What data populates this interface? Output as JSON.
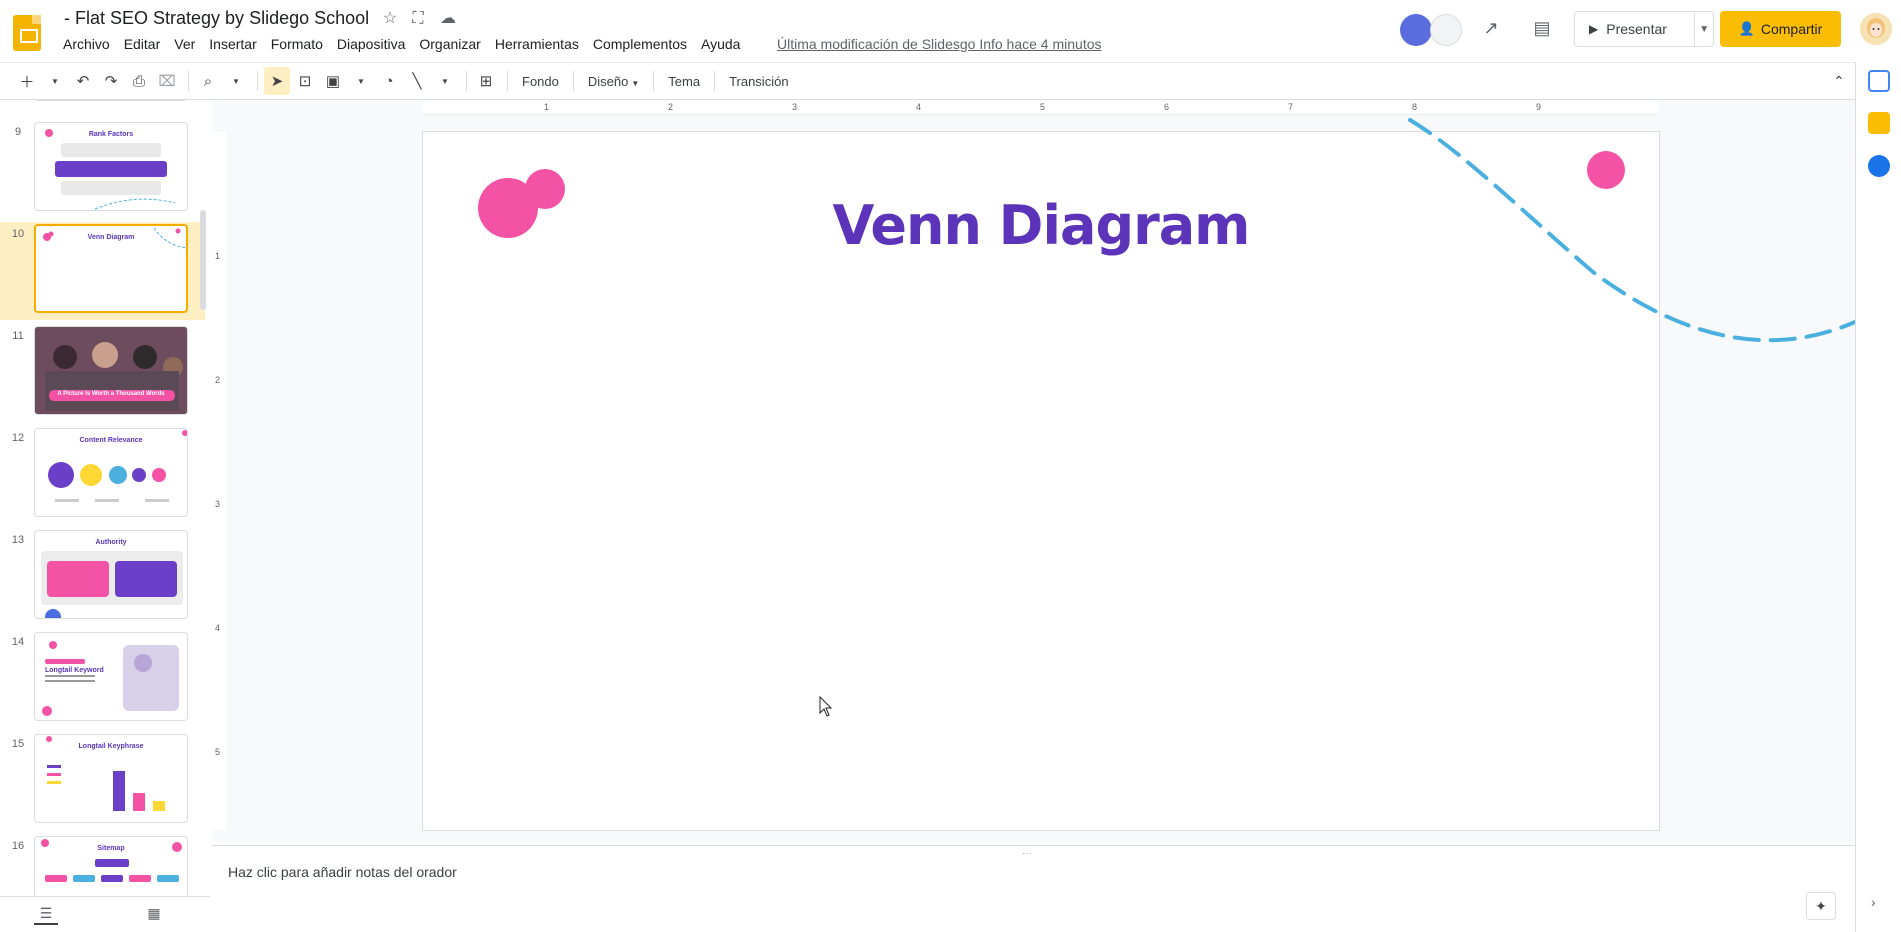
{
  "app": {
    "doc_title": "- Flat SEO Strategy by Slidego School",
    "last_edit": "Última modificación de Slidesgo Info hace 4 minutos",
    "menu": [
      "Archivo",
      "Editar",
      "Ver",
      "Insertar",
      "Formato",
      "Diapositiva",
      "Organizar",
      "Herramientas",
      "Complementos",
      "Ayuda"
    ],
    "present_label": "Presentar",
    "share_label": "Compartir",
    "accent": "#fbbc04"
  },
  "toolbar": {
    "background_label": "Fondo",
    "layout_label": "Diseño",
    "theme_label": "Tema",
    "transition_label": "Transición"
  },
  "filmstrip": {
    "selected": "10",
    "slides": [
      {
        "num": "9",
        "title": "Rank Factors"
      },
      {
        "num": "10",
        "title": "Venn Diagram"
      },
      {
        "num": "11",
        "title": "A Picture Is Worth a Thousand Words"
      },
      {
        "num": "12",
        "title": "Content Relevance"
      },
      {
        "num": "13",
        "title": "Authority"
      },
      {
        "num": "14",
        "title": "Longtail Keyword"
      },
      {
        "num": "15",
        "title": "Longtail Keyphrase"
      },
      {
        "num": "16",
        "title": "Sitemap"
      }
    ]
  },
  "ruler": {
    "h": [
      "1",
      "2",
      "3",
      "4",
      "5",
      "6",
      "7",
      "8",
      "9"
    ],
    "v": [
      "1",
      "2",
      "3",
      "4",
      "5"
    ]
  },
  "slide": {
    "title": "Venn Diagram",
    "title_color": "#5b34b9",
    "pink": "#f452a5",
    "blue": "#4bb0e0"
  },
  "notes": {
    "placeholder": "Haz clic para añadir notas del orador"
  }
}
